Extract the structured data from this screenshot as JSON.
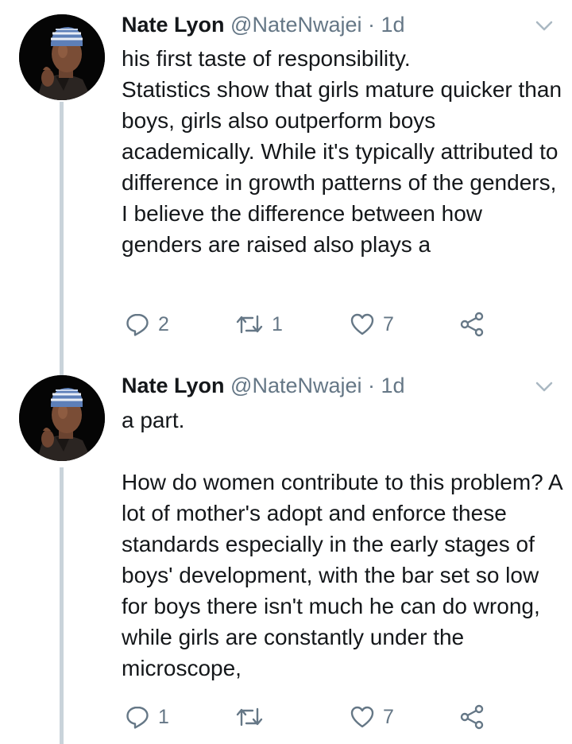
{
  "tweets": [
    {
      "author_name": "Nate Lyon",
      "handle": "@NateNwajei",
      "separator": "·",
      "time": "1d",
      "text": "his first taste of responsibility.\nStatistics show that girls mature quicker than boys, girls also outperform boys academically. While it's typically attributed to difference in growth patterns of the genders, I believe the difference between how genders are raised also plays a",
      "reply_count": "2",
      "retweet_count": "1",
      "like_count": "7"
    },
    {
      "author_name": "Nate Lyon",
      "handle": "@NateNwajei",
      "separator": "·",
      "time": "1d",
      "text": "a part.\n\nHow do women contribute to this problem? A lot of mother's adopt and enforce these standards especially in the early stages of boys' development, with the bar set so low for boys there isn't much he can do wrong, while girls are constantly under the microscope,",
      "reply_count": "1",
      "retweet_count": "",
      "like_count": "7"
    }
  ],
  "icons": {
    "reply": "reply-icon",
    "retweet": "retweet-icon",
    "like": "heart-icon",
    "share": "share-icon",
    "menu": "chevron-down-icon"
  },
  "colors": {
    "text": "#14171a",
    "secondary": "#657786",
    "thread_line": "#c9d3da",
    "background": "#ffffff"
  }
}
